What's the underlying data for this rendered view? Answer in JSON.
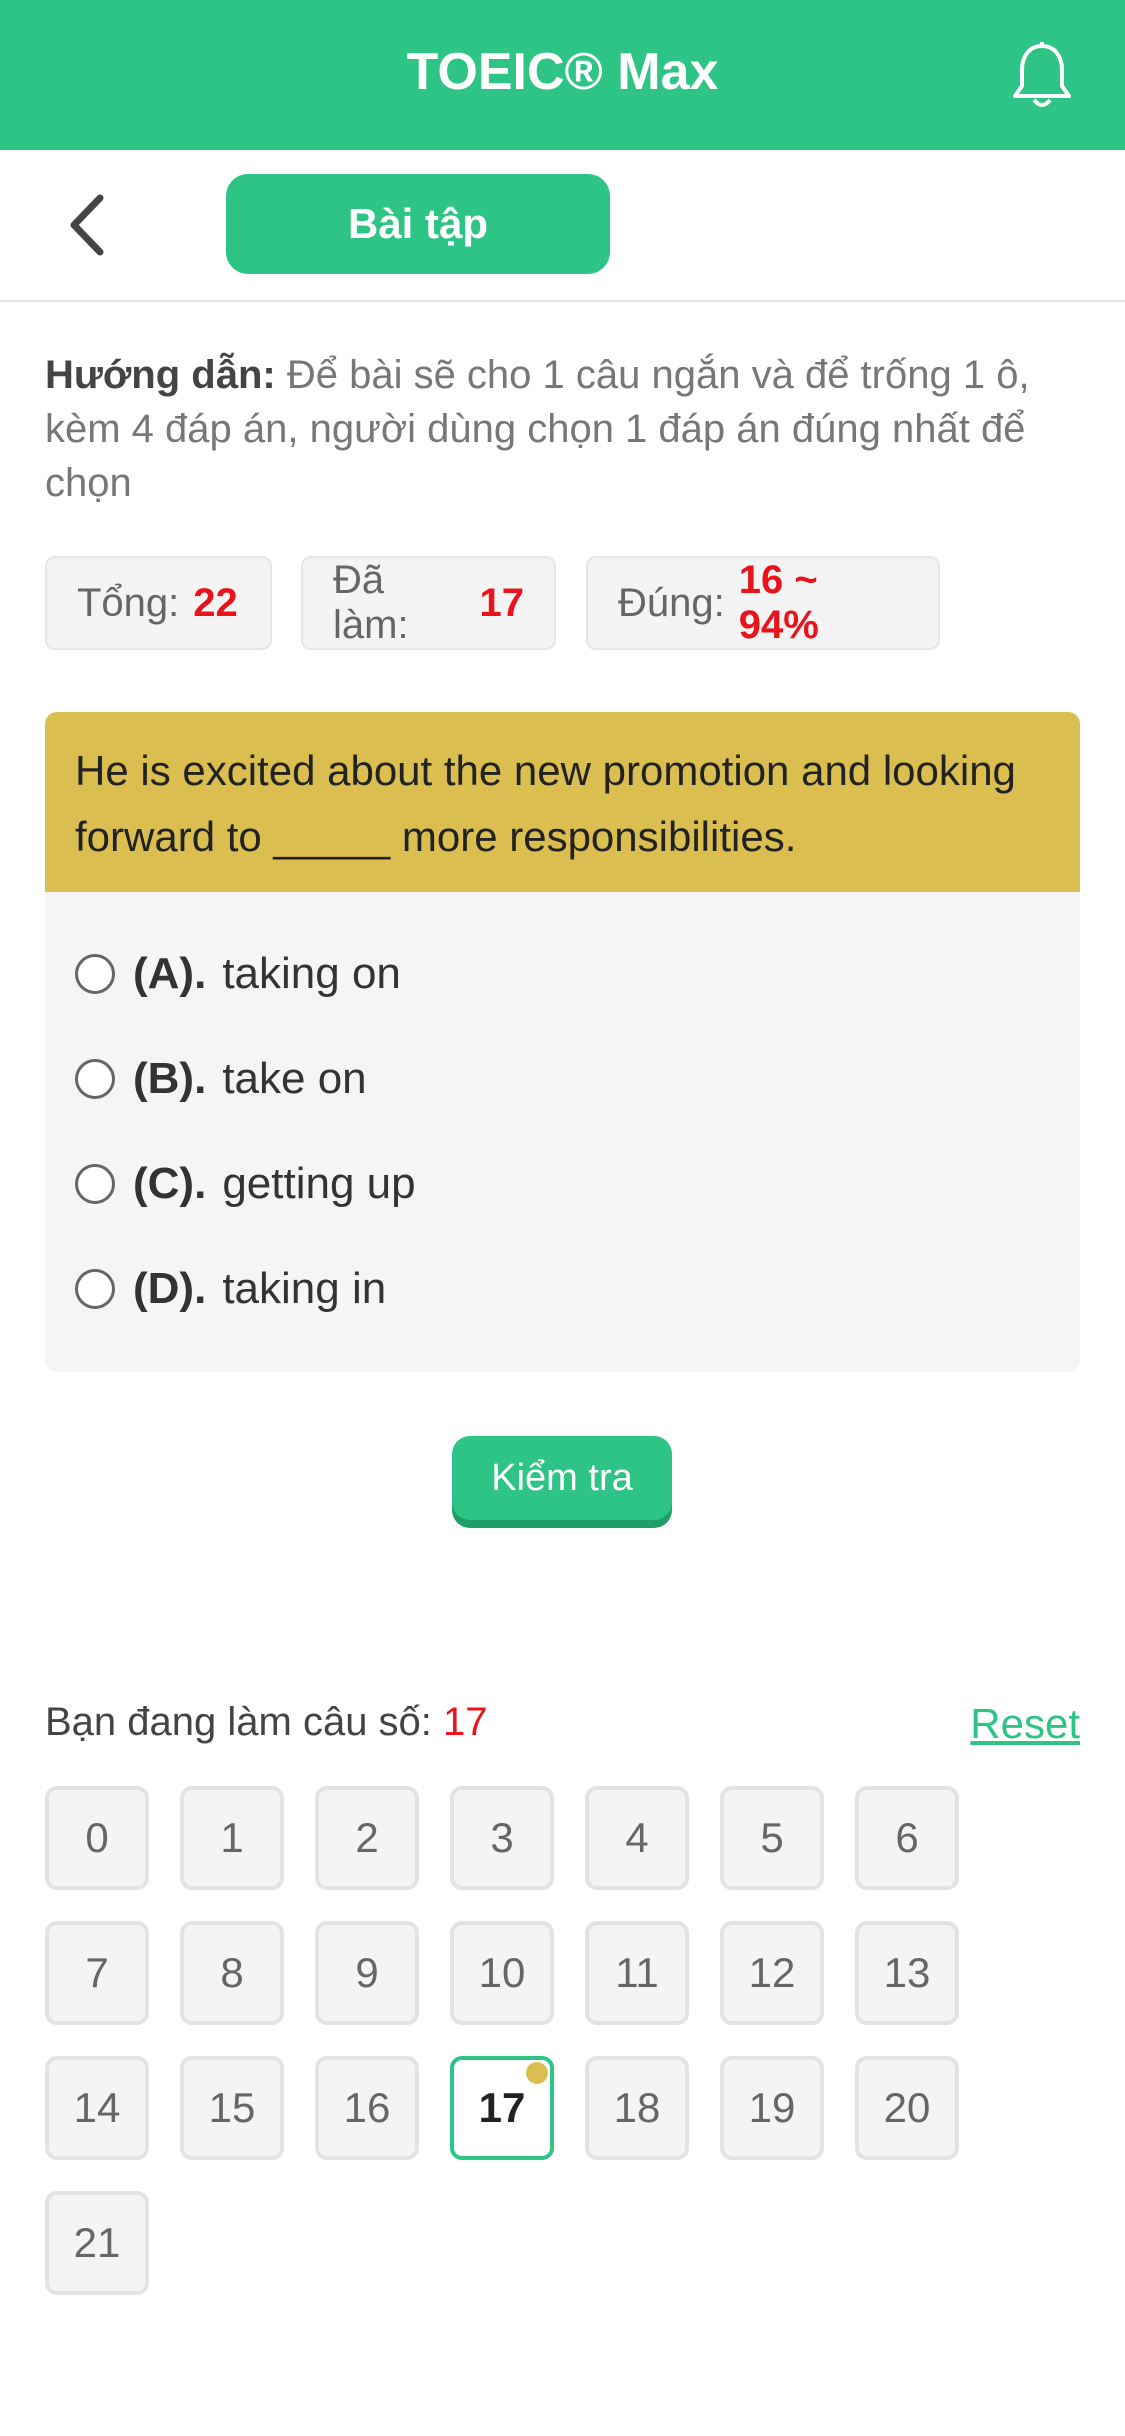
{
  "header": {
    "title": "TOEIC® Max",
    "icon": "bell-icon"
  },
  "subbar": {
    "back_icon": "chevron-left-icon",
    "tab_label": "Bài tập"
  },
  "guide": {
    "label": "Hướng dẫn:",
    "text": "Để bài sẽ cho 1 câu ngắn và để trống 1 ô, kèm 4 đáp án, người dùng chọn 1 đáp án đúng nhất để chọn"
  },
  "stats": {
    "total_label": "Tổng:",
    "total_value": "22",
    "done_label": "Đã làm:",
    "done_value": "17",
    "correct_label": "Đúng:",
    "correct_value": "16 ~ 94%"
  },
  "question": {
    "text": "He is excited about the new promotion and looking forward to _____ more responsibilities.",
    "options": [
      {
        "label": "(A).",
        "text": "taking on"
      },
      {
        "label": "(B).",
        "text": "take on"
      },
      {
        "label": "(C).",
        "text": "getting up"
      },
      {
        "label": "(D).",
        "text": "taking in"
      }
    ]
  },
  "check_button": "Kiểm tra",
  "progress": {
    "label": "Bạn đang làm câu số:",
    "current": "17",
    "reset": "Reset"
  },
  "numbers": [
    "0",
    "1",
    "2",
    "3",
    "4",
    "5",
    "6",
    "7",
    "8",
    "9",
    "10",
    "11",
    "12",
    "13",
    "14",
    "15",
    "16",
    "17",
    "18",
    "19",
    "20",
    "21"
  ],
  "colors": {
    "brand": "#2ec485",
    "question_bg": "#dabe4f",
    "highlight": "#e8131b"
  }
}
